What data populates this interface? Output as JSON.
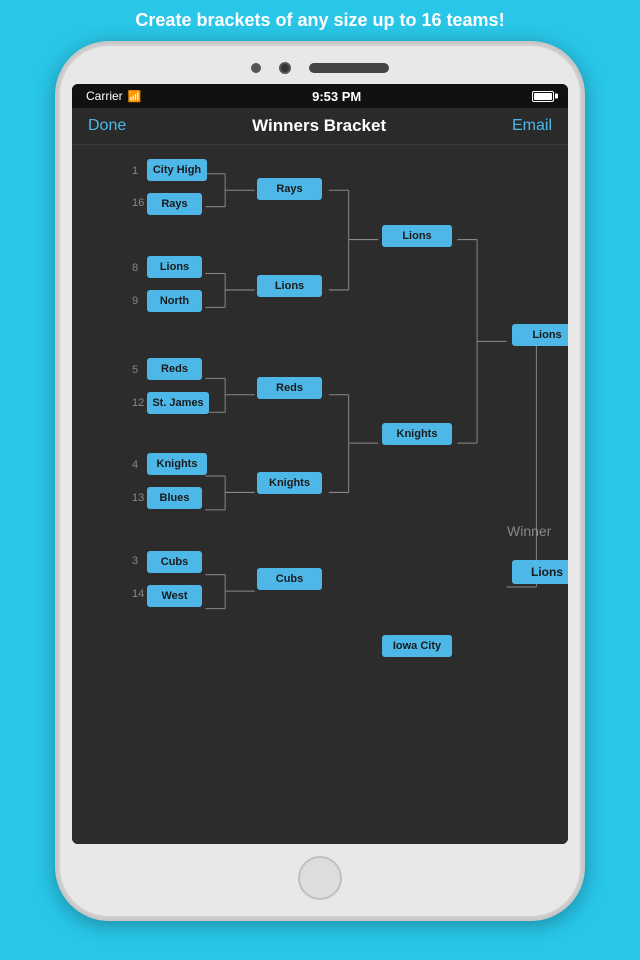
{
  "banner": {
    "text": "Create brackets of any size up to 16 teams!"
  },
  "status_bar": {
    "carrier": "Carrier",
    "time": "9:53 PM"
  },
  "nav": {
    "done": "Done",
    "title": "Winners Bracket",
    "email": "Email"
  },
  "seeds": [
    1,
    16,
    8,
    9,
    5,
    12,
    4,
    13,
    3,
    14
  ],
  "teams": {
    "r1": [
      {
        "id": "t1",
        "name": "City High"
      },
      {
        "id": "t2",
        "name": "Rays"
      },
      {
        "id": "t3",
        "name": "Lions"
      },
      {
        "id": "t4",
        "name": "North"
      },
      {
        "id": "t5",
        "name": "Reds"
      },
      {
        "id": "t6",
        "name": "St. James"
      },
      {
        "id": "t7",
        "name": "Knights"
      },
      {
        "id": "t8",
        "name": "Blues"
      },
      {
        "id": "t9",
        "name": "Cubs"
      },
      {
        "id": "t10",
        "name": "West"
      }
    ],
    "r2": [
      {
        "id": "r2t1",
        "name": "Rays"
      },
      {
        "id": "r2t2",
        "name": "Lions"
      },
      {
        "id": "r2t3",
        "name": "Reds"
      },
      {
        "id": "r2t4",
        "name": "Knights"
      },
      {
        "id": "r2t5",
        "name": "Cubs"
      }
    ],
    "r3": [
      {
        "id": "r3t1",
        "name": "Lions"
      },
      {
        "id": "r3t2",
        "name": "Knights"
      },
      {
        "id": "r3t3",
        "name": "Iowa City"
      }
    ],
    "r4": [
      {
        "id": "r4t1",
        "name": "Lions"
      }
    ],
    "winner": {
      "name": "Lions"
    }
  },
  "winner_label": "Winner"
}
